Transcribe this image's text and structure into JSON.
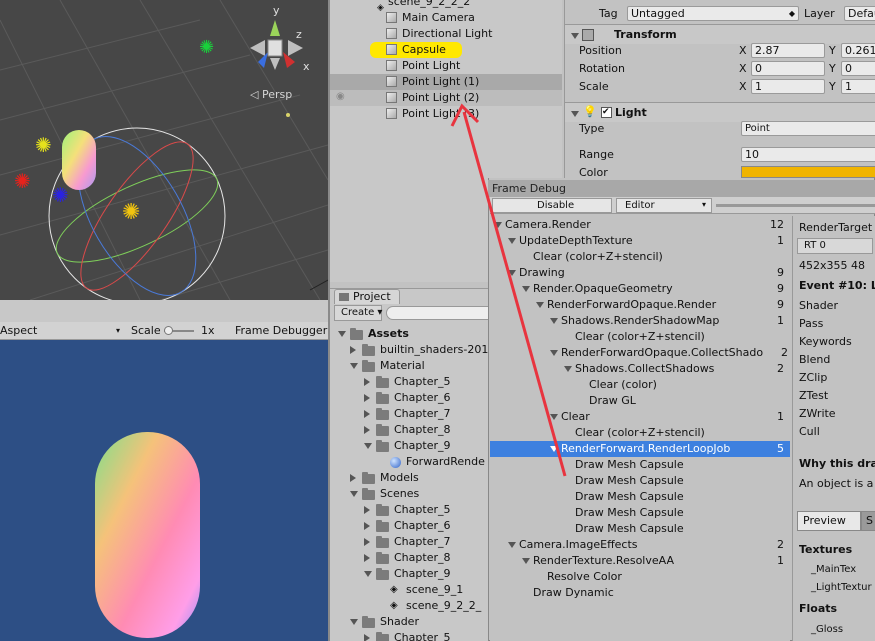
{
  "scene": {
    "persp_label": "◁ Persp",
    "axes": {
      "y": "y",
      "x": "x",
      "z": "z"
    }
  },
  "game_toolbar": {
    "aspect": "Aspect",
    "scale_label": "Scale",
    "scale_value": "1x",
    "frame_debugger": "Frame Debugger C"
  },
  "hierarchy": {
    "scene_name": "scene_9_2_2_2",
    "items": [
      "Main Camera",
      "Directional Light",
      "Capsule",
      "Point Light",
      "Point Light (1)",
      "Point Light (2)",
      "Point Light (3)"
    ]
  },
  "inspector": {
    "tag_label": "Tag",
    "tag_value": "Untagged",
    "layer_label": "Layer",
    "layer_value": "Defau",
    "transform": {
      "title": "Transform",
      "position": "Position",
      "rotation": "Rotation",
      "scale": "Scale",
      "x": "X",
      "y": "Y",
      "pos_x": "2.87",
      "pos_y": "0.261",
      "rot_x": "0",
      "rot_y": "0",
      "scale_x": "1",
      "scale_y": "1"
    },
    "light": {
      "title": "Light",
      "type_label": "Type",
      "type_value": "Point",
      "range_label": "Range",
      "range_value": "10",
      "color_label": "Color",
      "color": "#f0b400"
    }
  },
  "project": {
    "tab": "Project",
    "create": "Create ▾",
    "items": [
      "Assets",
      "builtin_shaders-201",
      "Material",
      "Chapter_5",
      "Chapter_6",
      "Chapter_7",
      "Chapter_8",
      "Chapter_9",
      "ForwardRende",
      "Models",
      "Scenes",
      "Chapter_5",
      "Chapter_6",
      "Chapter_7",
      "Chapter_8",
      "Chapter_9",
      "scene_9_1",
      "scene_9_2_2_",
      "Shader",
      "Chapter_5"
    ]
  },
  "frame_debug": {
    "title": "Frame Debug",
    "disable": "Disable",
    "editor": "Editor",
    "tree": [
      {
        "label": "Camera.Render",
        "count": "12"
      },
      {
        "label": "UpdateDepthTexture",
        "count": "1"
      },
      {
        "label": "Clear (color+Z+stencil)",
        "count": ""
      },
      {
        "label": "Drawing",
        "count": "9"
      },
      {
        "label": "Render.OpaqueGeometry",
        "count": "9"
      },
      {
        "label": "RenderForwardOpaque.Render",
        "count": "9"
      },
      {
        "label": "Shadows.RenderShadowMap",
        "count": "1"
      },
      {
        "label": "Clear (color+Z+stencil)",
        "count": ""
      },
      {
        "label": "RenderForwardOpaque.CollectShado",
        "count": "2"
      },
      {
        "label": "Shadows.CollectShadows",
        "count": "2"
      },
      {
        "label": "Clear (color)",
        "count": ""
      },
      {
        "label": "Draw GL",
        "count": ""
      },
      {
        "label": "Clear",
        "count": "1"
      },
      {
        "label": "Clear (color+Z+stencil)",
        "count": ""
      },
      {
        "label": "RenderForward.RenderLoopJob",
        "count": "5"
      },
      {
        "label": "Draw Mesh Capsule",
        "count": ""
      },
      {
        "label": "Draw Mesh Capsule",
        "count": ""
      },
      {
        "label": "Draw Mesh Capsule",
        "count": ""
      },
      {
        "label": "Draw Mesh Capsule",
        "count": ""
      },
      {
        "label": "Draw Mesh Capsule",
        "count": ""
      },
      {
        "label": "Camera.ImageEffects",
        "count": "2"
      },
      {
        "label": "RenderTexture.ResolveAA",
        "count": "1"
      },
      {
        "label": "Resolve Color",
        "count": ""
      },
      {
        "label": "Draw Dynamic",
        "count": ""
      }
    ],
    "right": {
      "render_target": "RenderTarget",
      "rt": "RT 0",
      "size": "452x355 48",
      "event": "Event #10: L",
      "props": [
        "Shader",
        "Pass",
        "Keywords",
        "Blend",
        "ZClip",
        "ZTest",
        "ZWrite",
        "Cull"
      ],
      "why": "Why this dra",
      "why_text": "An object is a",
      "preview": "Preview",
      "preview2": "S",
      "textures": "Textures",
      "tex1": "_MainTex",
      "tex2": "_LightTextur",
      "floats": "Floats",
      "float1": "_Gloss"
    }
  },
  "colors": {
    "selection": "#3d80df",
    "highlight": "#ffe800",
    "arrow": "#e8343f"
  }
}
